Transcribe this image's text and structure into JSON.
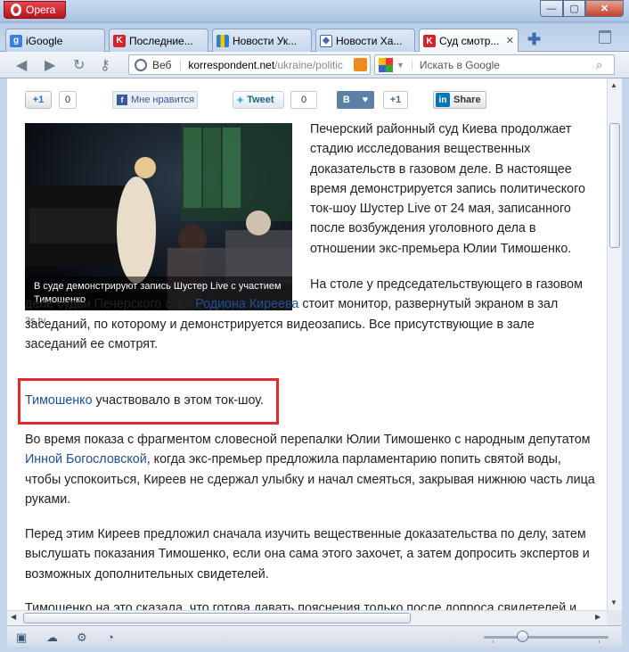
{
  "window": {
    "app_name": "Opera",
    "controls": {
      "minimize": "—",
      "maximize": "▢",
      "close": "✕"
    }
  },
  "tabs": [
    {
      "label": "iGoogle",
      "favicon": "google-icon",
      "color": "#3a7ee4"
    },
    {
      "label": "Последние...",
      "favicon": "korrespondent-icon",
      "color": "#d8232a"
    },
    {
      "label": "Новости Ук...",
      "favicon": "bars-icon",
      "color": "#2d80c8"
    },
    {
      "label": "Новости Ха...",
      "favicon": "diamond-icon",
      "color": "#4466aa"
    },
    {
      "label": "Суд смотр...",
      "favicon": "korrespondent-icon",
      "color": "#d8232a",
      "active": true
    }
  ],
  "toolbar": {
    "addr_prefix": "Веб",
    "url_domain": "korrespondent.net",
    "url_path": "/ukraine/politic",
    "search_placeholder": "Искать в Google"
  },
  "share": {
    "plus1": "+1",
    "plus1_count": "0",
    "fb_label": "Мне нравится",
    "tweet_label": "Tweet",
    "tweet_count": "0",
    "vk_label": "В",
    "vk_count": "+1",
    "li_label": "Share"
  },
  "article": {
    "photo_caption": "В суде демонстрируют запись Шустер Live с участием Тимошенко",
    "photo_credit": "3s.tv",
    "p1": "Печерский районный суд Киева продолжает стадию исследования вещественных доказательств в газовом деле. В настоящее время демонстрируется запись политического ток-шоу Шустер Live от 24 мая, записанного после возбуждения уголовного дела в отношении экс-премьера Юлии Тимошенко.",
    "p2_before": "На столе у председательствующего в газовом деле судьи Печерского суда ",
    "p2_link": "Родиона Киреева",
    "p2_after": " стоит монитор, развернутый экраном в зал заседаний, по которому и демонстрируется видеозапись. Все присутствующие в зале заседаний ее смотрят.",
    "p3_link": "Тимошенко",
    "p3_after": " участвовало в этом ток-шоу.",
    "p4_before": "Во время показа с фрагментом словесной перепалки Юлии Тимошенко с народным депутатом ",
    "p4_link": "Инной Богословской",
    "p4_after": ", когда экс-премьер предложила парламентарию попить святой воды, чтобы успокоиться, Киреев не сдержал улыбку и начал смеяться, закрывая нижнюю часть лица руками.",
    "p5": "Перед этим Киреев предложил сначала изучить вещественные доказательства по делу, затем выслушать показания Тимошенко, если она сама этого захочет, а затем допросить экспертов и возможных дополнительных свидетелей.",
    "p6_partial": "Тимошенко на это сказала, что готова давать пояснения только после допроса свидетелей и"
  },
  "status": {
    "zoom_level": 0.3
  }
}
